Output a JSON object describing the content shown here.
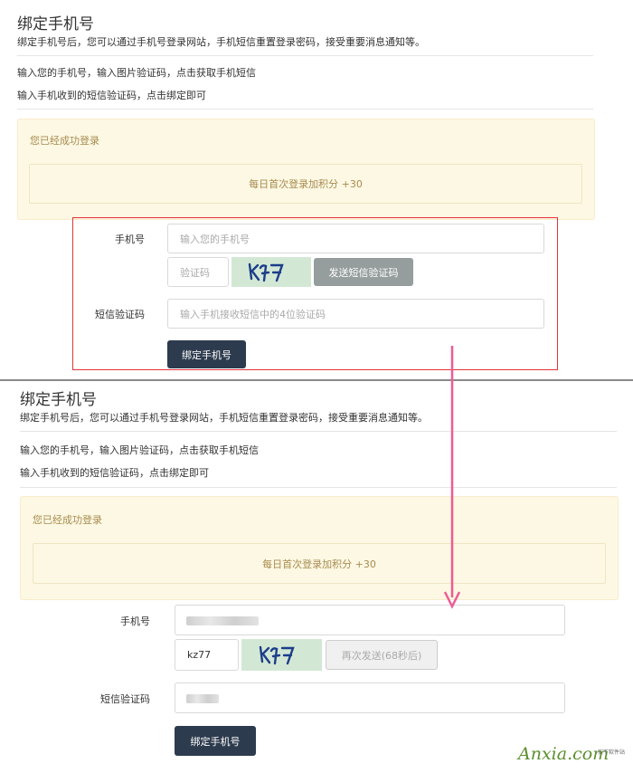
{
  "page": {
    "title": "绑定手机号",
    "description": "绑定手机号后，您可以通过手机号登录网站，手机短信重置登录密码，接受重要消息通知等。",
    "instruction_1": "输入您的手机号，输入图片验证码，点击获取手机短信",
    "instruction_2": "输入手机收到的短信验证码，点击绑定即可"
  },
  "notice": {
    "heading": "您已经成功登录",
    "message": "每日首次登录加积分 +30"
  },
  "form_before": {
    "phone_label": "手机号",
    "phone_placeholder": "输入您的手机号",
    "captcha_placeholder": "验证码",
    "captcha_image_text": "kz77",
    "send_button": "发送短信验证码",
    "sms_label": "短信验证码",
    "sms_placeholder": "输入手机接收短信中的4位验证码",
    "submit_button": "绑定手机号"
  },
  "form_after": {
    "phone_label": "手机号",
    "captcha_value": "kz77",
    "captcha_image_text": "kz77",
    "resend_button": "再次发送(68秒后)",
    "sms_label": "短信验证码",
    "submit_button": "绑定手机号"
  },
  "watermark": {
    "brand": "Anxia.com",
    "sub": "安下软件站"
  },
  "colors": {
    "highlight_box": "#e4333a",
    "arrow": "#ee5b95",
    "notice_bg": "#fcf8e3",
    "notice_text": "#a88b50",
    "dark_button": "#2d3b4e"
  }
}
